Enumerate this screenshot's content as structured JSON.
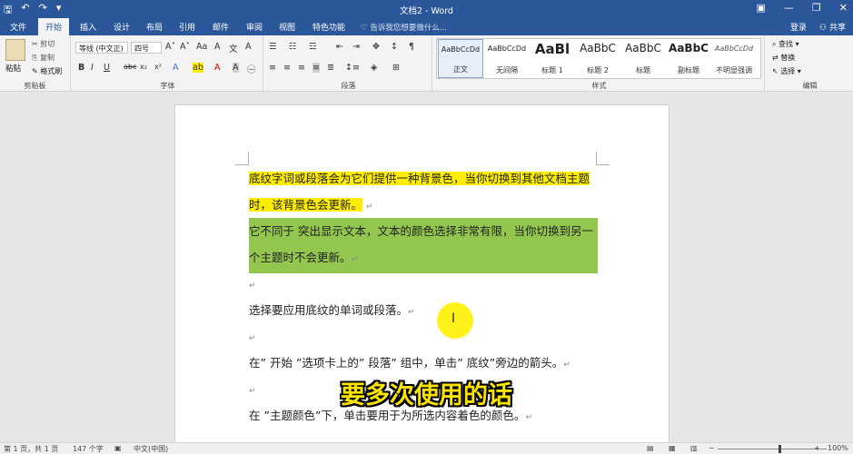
{
  "titlebar": {
    "title": "文档2 - Word",
    "qat": [
      "🖫",
      "↶",
      "↷",
      "▾"
    ],
    "window_controls": [
      "▣",
      "—",
      "❐",
      "✕"
    ]
  },
  "tabs": {
    "file": "文件",
    "home": "开始",
    "insert": "插入",
    "design": "设计",
    "layout": "布局",
    "references": "引用",
    "mailings": "邮件",
    "review": "审阅",
    "view": "视图",
    "special": "特色功能",
    "tell_me": "告诉我您想要做什么...",
    "login": "登录",
    "share": "共享"
  },
  "ribbon": {
    "clipboard": {
      "label": "剪贴板",
      "paste": "粘贴",
      "cut": "剪切",
      "copy": "复制",
      "format_painter": "格式刷"
    },
    "font": {
      "label": "字体",
      "font_name": "等线 (中文正)",
      "font_size": "四号"
    },
    "paragraph": {
      "label": "段落"
    },
    "styles": {
      "label": "样式",
      "items": [
        {
          "sample": "AaBbCcDd",
          "name": "正文"
        },
        {
          "sample": "AaBbCcDd",
          "name": "无间隔"
        },
        {
          "sample": "AaBl",
          "name": "标题 1"
        },
        {
          "sample": "AaBbC",
          "name": "标题 2"
        },
        {
          "sample": "AaBbC",
          "name": "标题"
        },
        {
          "sample": "AaBbC",
          "name": "副标题"
        },
        {
          "sample": "AaBbCcDd",
          "name": "不明显强调"
        }
      ]
    },
    "editing": {
      "label": "编辑",
      "find": "查找",
      "replace": "替换",
      "select": "选择"
    }
  },
  "document": {
    "para1": "底纹字词或段落会为它们提供一种背景色，当你切换到其他文档主题时，该背景色会更新。",
    "para2": "它不同于 突出显示文本，文本的颜色选择非常有限，当你切换到另一个主题时不会更新。",
    "para3": "选择要应用底纹的单词或段落。",
    "para4": "在” 开始 ”选项卡上的” 段落” 组中，单击” 底纹”旁边的箭头。",
    "para5": "在 ”主题颜色”下，单击要用于为所选内容着色的颜色。",
    "paragraph_mark": "↵"
  },
  "subtitle": "要多次使用的话",
  "statusbar": {
    "page": "第 1 页，共 1 页",
    "words": "147 个字",
    "language": "中文(中国)",
    "zoom": "100%",
    "zoom_minus": "−",
    "zoom_plus": "+"
  },
  "colors": {
    "title_blue": "#2b579a",
    "highlight_yellow": "#ffed00",
    "shading_green": "#92c64f",
    "subtitle_yellow": "#fbe300"
  }
}
